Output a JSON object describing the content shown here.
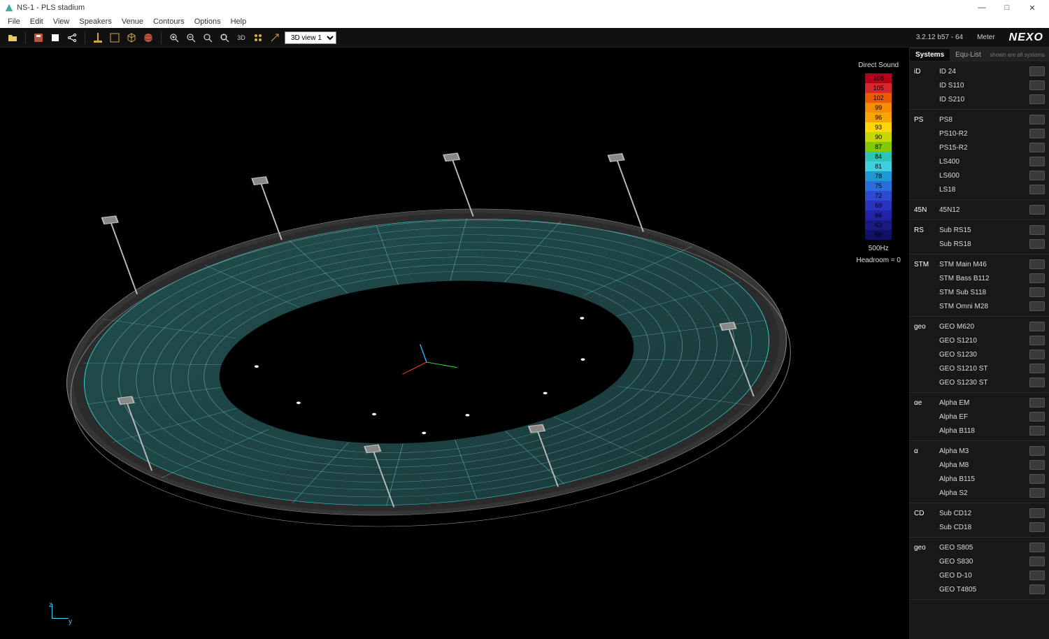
{
  "window": {
    "title": "NS-1 - PLS stadium",
    "minimize": "—",
    "maximize": "□",
    "close": "✕"
  },
  "menu": [
    "File",
    "Edit",
    "View",
    "Speakers",
    "Venue",
    "Contours",
    "Options",
    "Help"
  ],
  "toolbar": {
    "view_select": "3D view 1",
    "version": "3.2.12 b57 - 64",
    "units": "Meter",
    "brand": "NEXO"
  },
  "legend": {
    "title": "Direct Sound",
    "steps": [
      {
        "label": "108",
        "color": "#B3001B"
      },
      {
        "label": "105",
        "color": "#D62828"
      },
      {
        "label": "102",
        "color": "#E85D04"
      },
      {
        "label": "99",
        "color": "#F48C06"
      },
      {
        "label": "96",
        "color": "#FAA307"
      },
      {
        "label": "93",
        "color": "#FFD60A"
      },
      {
        "label": "90",
        "color": "#C5D600"
      },
      {
        "label": "87",
        "color": "#80C904"
      },
      {
        "label": "84",
        "color": "#2EC4B6"
      },
      {
        "label": "81",
        "color": "#3FD0E0"
      },
      {
        "label": "78",
        "color": "#2098D1"
      },
      {
        "label": "75",
        "color": "#2A6FDB"
      },
      {
        "label": "72",
        "color": "#2E4AD1"
      },
      {
        "label": "69",
        "color": "#2933BF"
      },
      {
        "label": "66",
        "color": "#2222A7"
      },
      {
        "label": "63",
        "color": "#191982"
      },
      {
        "label": "60",
        "color": "#101066"
      }
    ],
    "freq": "500Hz",
    "headroom": "Headroom = 0"
  },
  "tabs": {
    "systems": "Systems",
    "equlist": "Equ-List",
    "hint": "shown are all systems"
  },
  "speaker_groups": [
    {
      "logo": "iD",
      "items": [
        "ID 24",
        "ID S110",
        "ID S210"
      ]
    },
    {
      "logo": "PS",
      "items": [
        "PS8",
        "PS10-R2",
        "PS15-R2",
        "LS400",
        "LS600",
        "LS18"
      ]
    },
    {
      "logo": "45N",
      "items": [
        "45N12"
      ]
    },
    {
      "logo": "RS",
      "items": [
        "Sub RS15",
        "Sub RS18"
      ]
    },
    {
      "logo": "STM",
      "items": [
        "STM Main M46",
        "STM Bass B112",
        "STM Sub S118",
        "STM Omni M28"
      ]
    },
    {
      "logo": "geo",
      "items": [
        "GEO M620",
        "GEO S1210",
        "GEO S1230",
        "GEO S1210 ST",
        "GEO S1230 ST"
      ]
    },
    {
      "logo": "αe",
      "items": [
        "Alpha EM",
        "Alpha EF",
        "Alpha B118"
      ]
    },
    {
      "logo": "α",
      "items": [
        "Alpha M3",
        "Alpha M8",
        "Alpha B115",
        "Alpha S2"
      ]
    },
    {
      "logo": "CD",
      "items": [
        "Sub CD12",
        "Sub CD18"
      ]
    },
    {
      "logo": "geo",
      "items": [
        "GEO S805",
        "GEO S830",
        "GEO D-10",
        "GEO T4805"
      ]
    }
  ],
  "axis": {
    "z": "z",
    "y": "y"
  }
}
